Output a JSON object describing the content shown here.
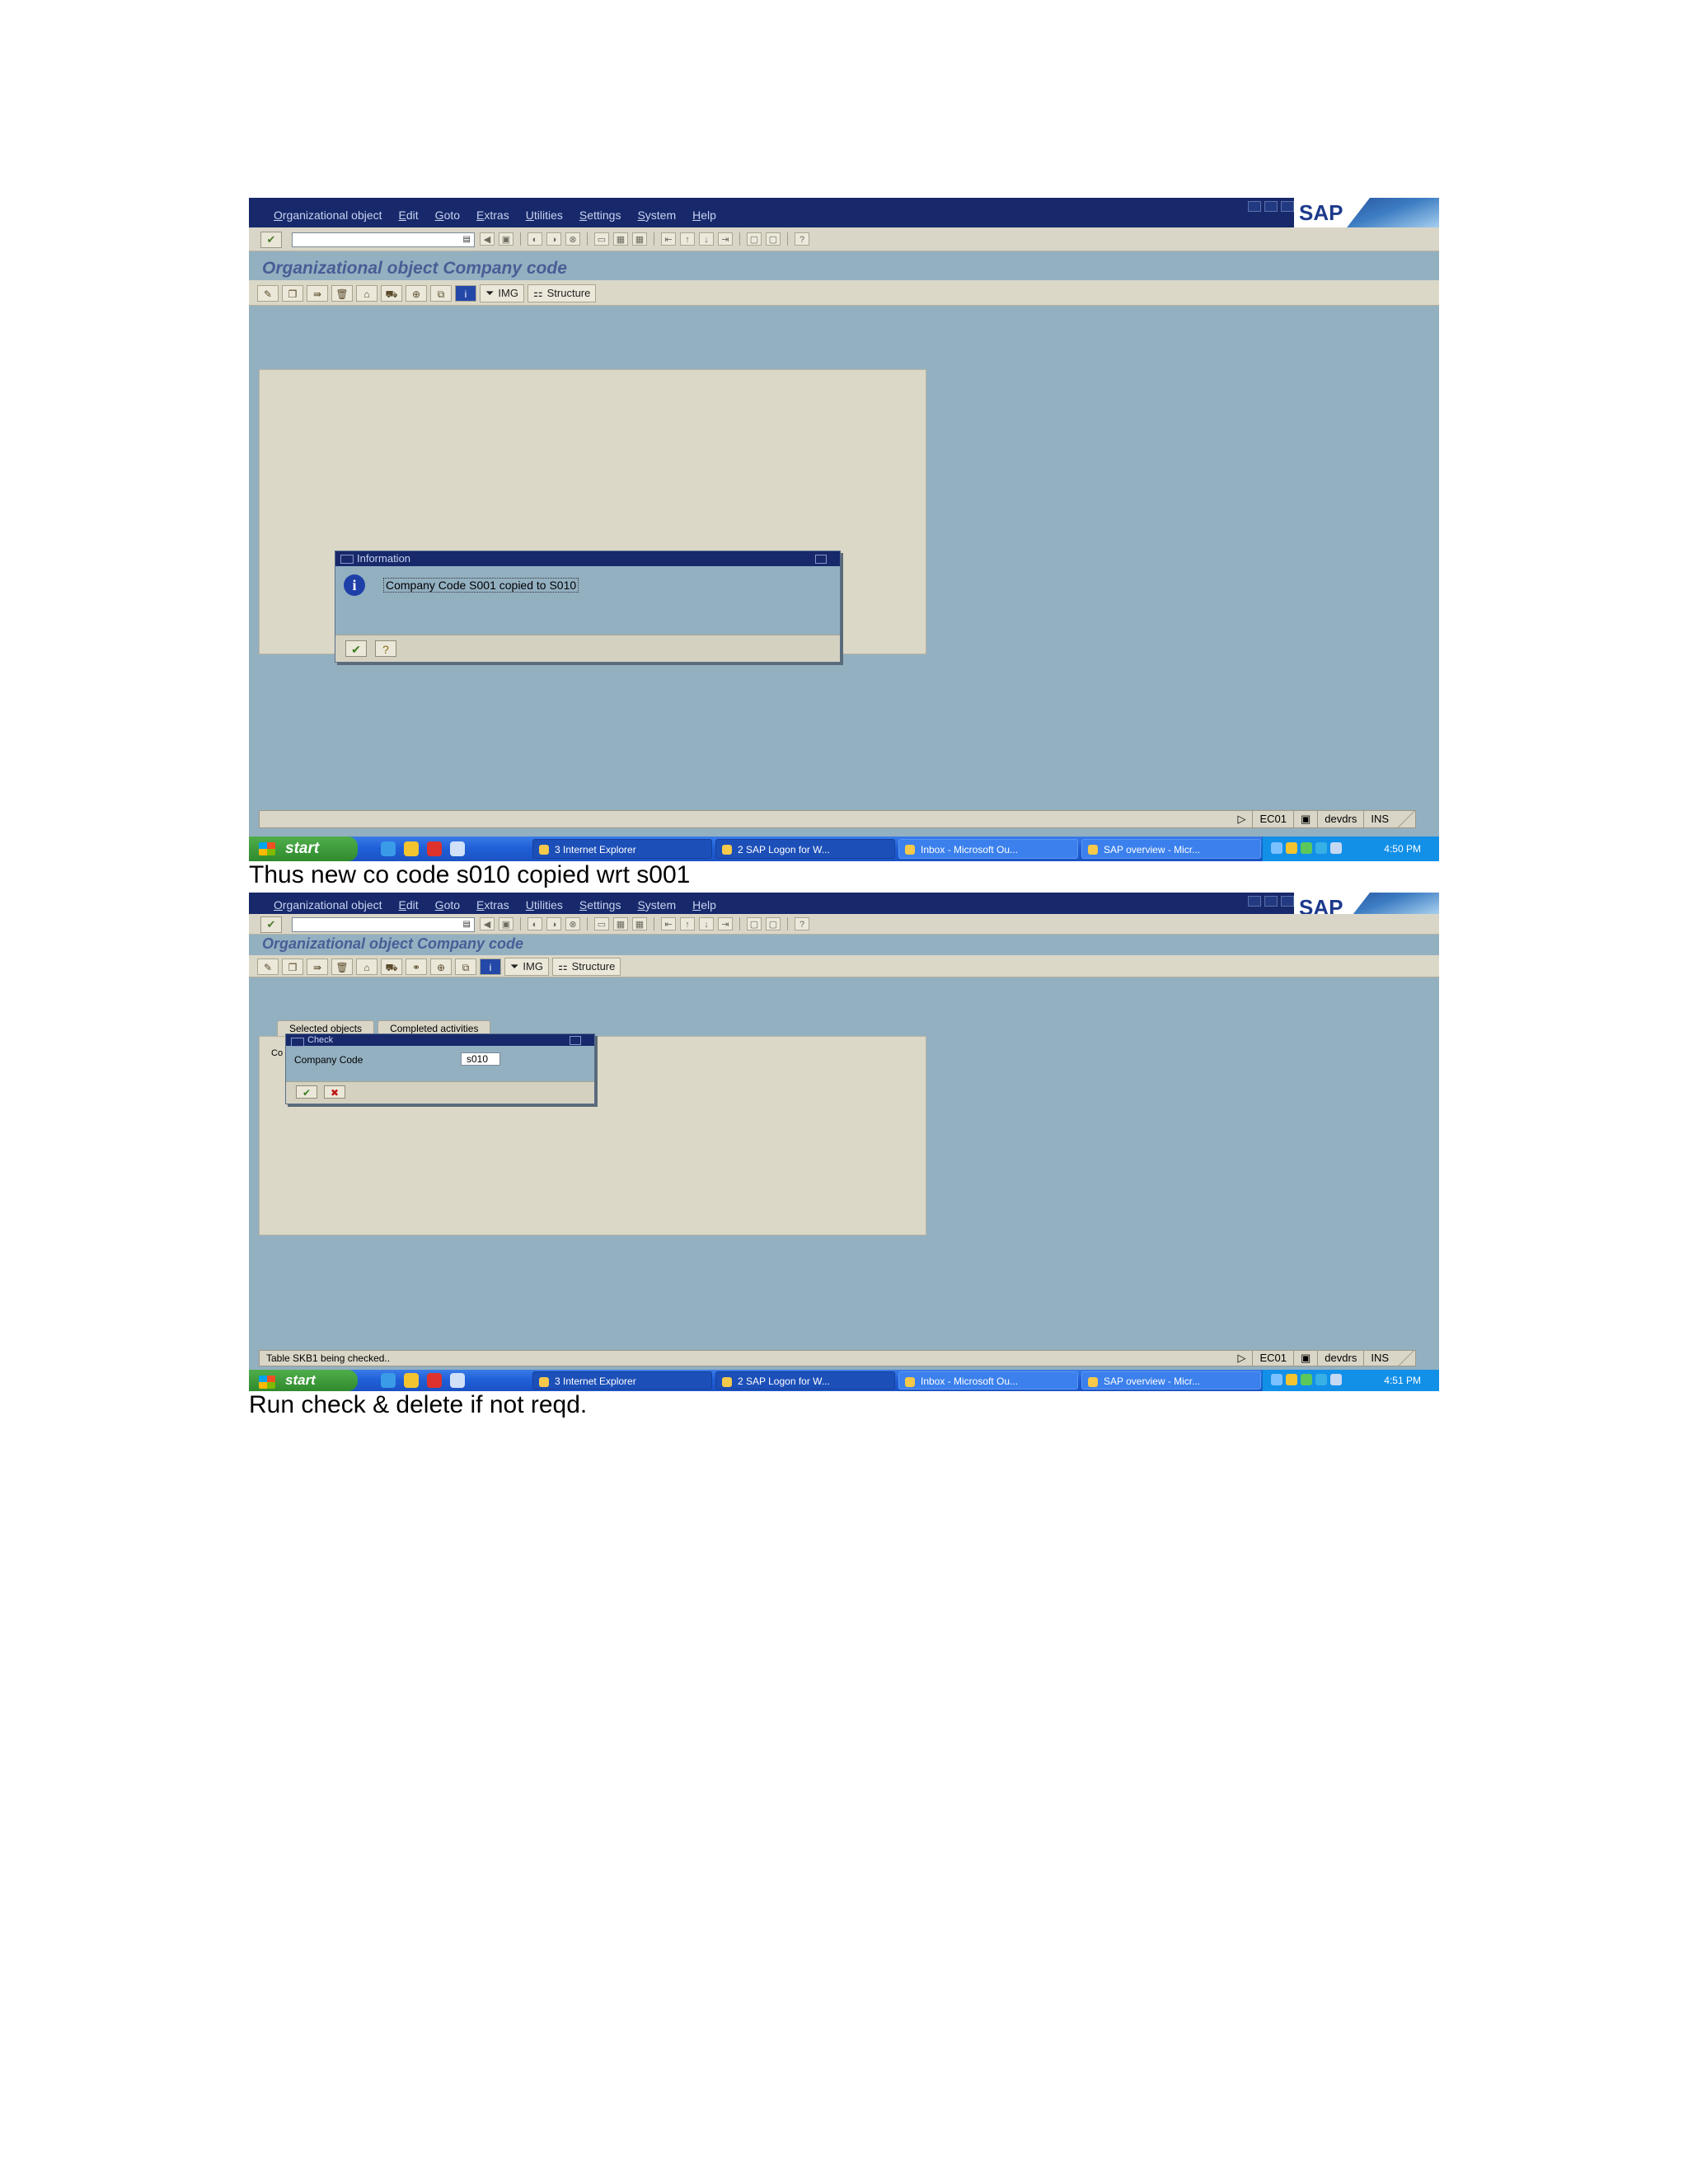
{
  "screenshots": [
    {
      "menu": [
        "Organizational object",
        "Edit",
        "Goto",
        "Extras",
        "Utilities",
        "Settings",
        "System",
        "Help"
      ],
      "sap_logo": "SAP",
      "page_title": "Organizational object Company code",
      "app_toolbar": {
        "img_label": "IMG",
        "structure_label": "Structure"
      },
      "dialog": {
        "title": "Information",
        "message": "Company Code S001 copied to S010"
      },
      "status": {
        "message": "",
        "system": "EC01",
        "user": "devdrs",
        "mode": "INS"
      },
      "taskbar": {
        "start": "start",
        "tasks": [
          "3 Internet Explorer",
          "2 SAP Logon for W...",
          "Inbox - Microsoft Ou...",
          "SAP overview - Micr..."
        ],
        "clock": "4:50 PM"
      }
    },
    {
      "menu": [
        "Organizational object",
        "Edit",
        "Goto",
        "Extras",
        "Utilities",
        "Settings",
        "System",
        "Help"
      ],
      "sap_logo": "SAP",
      "page_title": "Organizational object Company code",
      "app_toolbar": {
        "img_label": "IMG",
        "structure_label": "Structure"
      },
      "tabs": [
        "Selected objects",
        "Completed activities"
      ],
      "panel_fragment": "Co",
      "dialog": {
        "title": "Check",
        "field_label": "Company Code",
        "field_value": "s010"
      },
      "status": {
        "message": "Table SKB1 being checked..",
        "system": "EC01",
        "user": "devdrs",
        "mode": "INS"
      },
      "taskbar": {
        "start": "start",
        "tasks": [
          "3 Internet Explorer",
          "2 SAP Logon for W...",
          "Inbox - Microsoft Ou...",
          "SAP overview - Micr..."
        ],
        "clock": "4:51 PM"
      }
    }
  ],
  "captions": [
    "Thus new co code s010 copied wrt s001",
    "Run check & delete if not reqd."
  ],
  "colors": {
    "sap_frame": "#93b0c1",
    "title_bar": "#17296b",
    "toolbar": "#d9d6c7",
    "taskbar": "#2060d8"
  }
}
